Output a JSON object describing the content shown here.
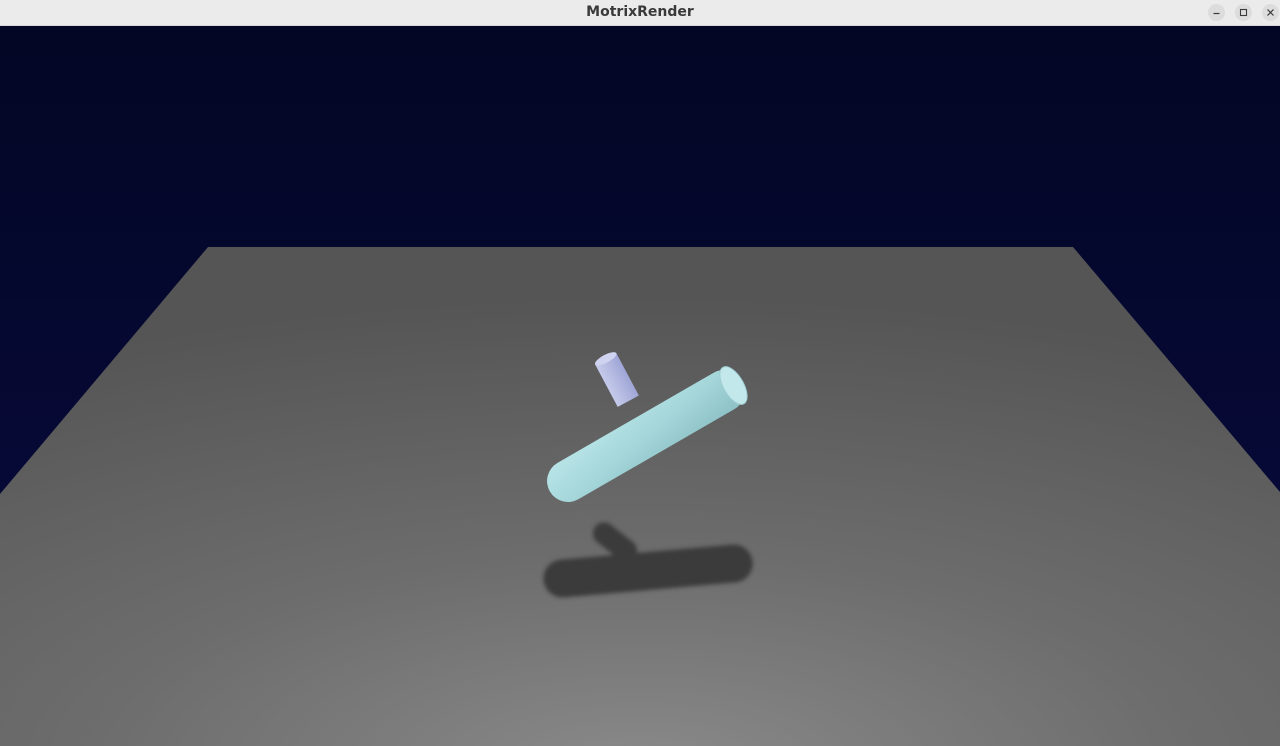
{
  "window": {
    "title": "MotrixRender",
    "controls": {
      "minimize_icon": "minimize-icon",
      "maximize_icon": "maximize-icon",
      "close_icon": "close-icon"
    }
  },
  "scene": {
    "background_color": "#050925",
    "floor_color": "#6a6a6a",
    "object_color": "#a8dade",
    "object_cap_color": "#bfe7ea",
    "small_cylinder_color": "#b6bde6",
    "shadow_color": "#3a3a3a"
  }
}
